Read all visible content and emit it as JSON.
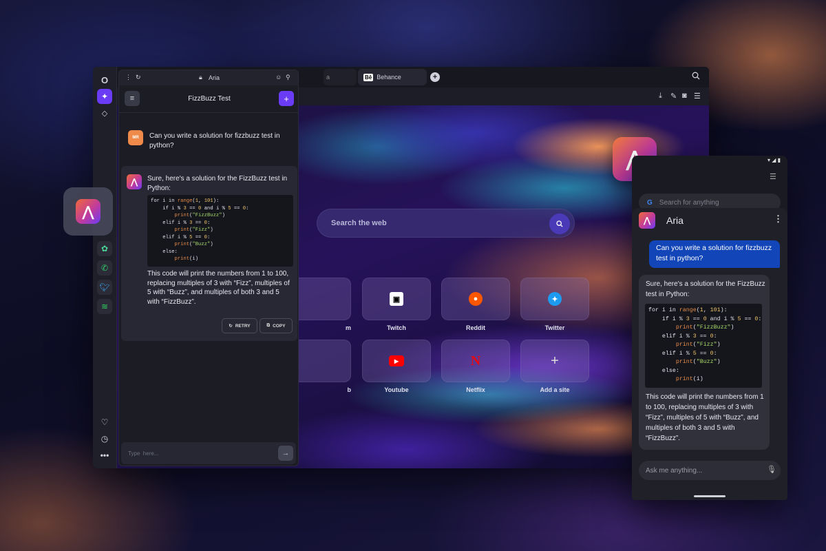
{
  "browser": {
    "tabs": {
      "active_label": "Behance",
      "active_badge": "Bē",
      "partial_label": "a"
    },
    "new_tab_symbol": "+",
    "sidebar_icons": [
      "opera-logo",
      "aria-icon",
      "diamond-icon",
      "chatgpt-icon",
      "whatsapp-icon",
      "twitter-icon",
      "spotify-icon",
      "heart-icon",
      "clock-icon",
      "more-icon"
    ]
  },
  "speed_dial": {
    "search_placeholder": "Search the web",
    "row1": [
      {
        "label": "m",
        "icon": "partial-icon"
      },
      {
        "label": "Twitch",
        "icon": "twitch-icon"
      },
      {
        "label": "Reddit",
        "icon": "reddit-icon"
      },
      {
        "label": "Twitter",
        "icon": "twitter-icon"
      }
    ],
    "row2": [
      {
        "label": "b",
        "icon": "partial-icon"
      },
      {
        "label": "Youtube",
        "icon": "youtube-icon"
      },
      {
        "label": "Netflix",
        "icon": "netflix-icon"
      },
      {
        "label": "Add a site",
        "icon": "plus-icon"
      }
    ]
  },
  "aria_panel": {
    "top_label": "Aria",
    "title": "FizzBuzz Test",
    "user_initials": "MR",
    "user_message": "Can you write a solution for fizzbuzz test in python?",
    "answer_intro": "Sure, here's a solution for the FizzBuzz test in Python:",
    "answer_outro": "This code will print the numbers from 1 to 100, replacing multiples of 3 with “Fizz”, multiples of 5 with “Buzz”, and multiples of both 3 and 5 with “FizzBuzz”.",
    "retry_label": "RETRY",
    "copy_label": "COPY",
    "input_placeholder": "Type  here..."
  },
  "phone": {
    "google_placeholder": "Search for anything",
    "title": "Aria",
    "user_message": "Can you write a solution for fizzbuzz test in python?",
    "answer_intro": "Sure, here's a solution for the FizzBuzz test in Python:",
    "answer_outro": "This code will print the numbers from 1 to 100, replacing multiples of 3 with “Fizz”, multiples of 5 with “Buzz”, and multiples of both 3 and 5 with “FizzBuzz”.",
    "input_placeholder": "Ask me anything..."
  },
  "code_lines": [
    "for i in range(1, 101):",
    "    if i % 3 == 0 and i % 5 == 0:",
    "        print(\"FizzBuzz\")",
    "    elif i % 3 == 0:",
    "        print(\"Fizz\")",
    "    elif i % 5 == 0:",
    "        print(\"Buzz\")",
    "    else:",
    "        print(i)"
  ],
  "colors": {
    "accent": "#6a3cf5",
    "user_bubble": "#1245b8",
    "avatar": "#ef8a4a"
  }
}
